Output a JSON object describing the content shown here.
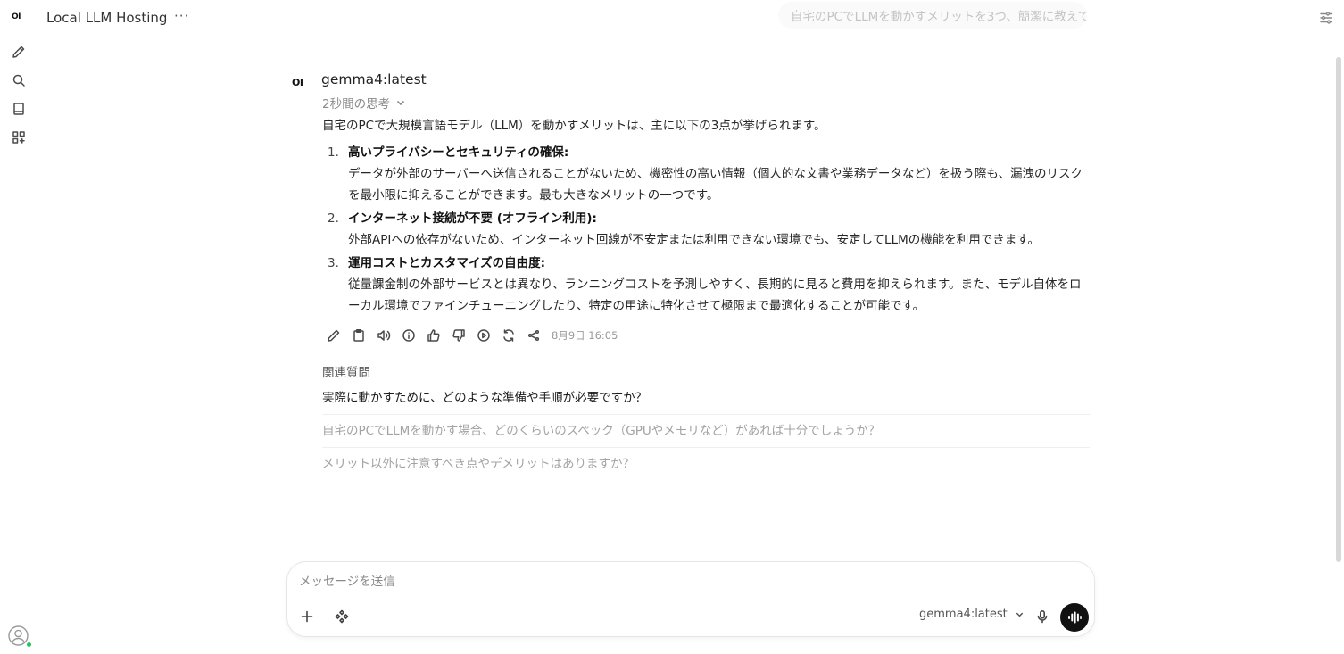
{
  "rail": {
    "logo": "OI",
    "items": [
      {
        "name": "new-chat",
        "icon": "pencil-icon"
      },
      {
        "name": "search",
        "icon": "search-icon"
      },
      {
        "name": "notes",
        "icon": "notebook-icon"
      },
      {
        "name": "workspace",
        "icon": "apps-grid-icon"
      }
    ],
    "user_status_color": "#22c55e"
  },
  "topbar": {
    "title": "Local LLM Hosting",
    "more": "···",
    "prompt_preview": "自宅のPCでLLMを動かすメリットを3つ、簡潔に教えて"
  },
  "message": {
    "avatar": "OI",
    "model": "gemma4:latest",
    "thinking": "2秒間の思考",
    "intro": "自宅のPCで大規模言語モデル（LLM）を動かすメリットは、主に以下の3点が挙げられます。",
    "points": [
      {
        "num": "1.",
        "head": "高いプライバシーとセキュリティの確保:",
        "body": "データが外部のサーバーへ送信されることがないため、機密性の高い情報（個人的な文書や業務データなど）を扱う際も、漏洩のリスクを最小限に抑えることができます。最も大きなメリットの一つです。"
      },
      {
        "num": "2.",
        "head": "インターネット接続が不要 (オフライン利用):",
        "body": "外部APIへの依存がないため、インターネット回線が不安定または利用できない環境でも、安定してLLMの機能を利用できます。"
      },
      {
        "num": "3.",
        "head": "運用コストとカスタマイズの自由度:",
        "body": "従量課金制の外部サービスとは異なり、ランニングコストを予測しやすく、長期的に見ると費用を抑えられます。また、モデル自体をローカル環境でファインチューニングしたり、特定の用途に特化させて極限まで最適化することが可能です。"
      }
    ],
    "timestamp": "8月9日 16:05"
  },
  "related": {
    "label": "関連質問",
    "items": [
      "実際に動かすために、どのような準備や手順が必要ですか？",
      "自宅のPCでLLMを動かす場合、どのくらいのスペック（GPUやメモリなど）があれば十分でしょうか？",
      "メリット以外に注意すべき点やデメリットはありますか？"
    ]
  },
  "composer": {
    "placeholder": "メッセージを送信",
    "model": "gemma4:latest"
  }
}
